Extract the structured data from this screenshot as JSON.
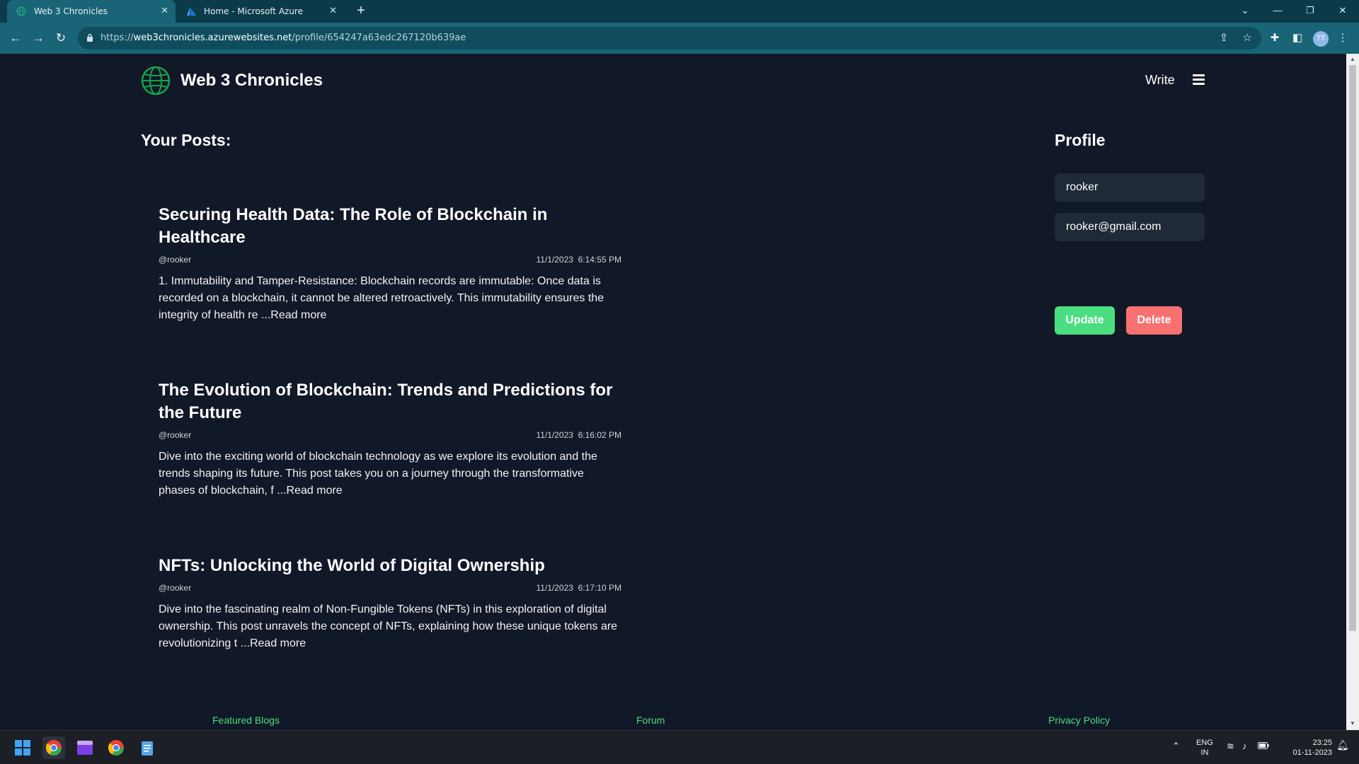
{
  "browser": {
    "tabs": [
      {
        "title": "Web 3 Chronicles"
      },
      {
        "title": "Home - Microsoft Azure"
      }
    ],
    "url_prefix": "https://",
    "url_host": "web3chronicles.azurewebsites.net",
    "url_path": "/profile/654247a63edc267120b639ae",
    "avatar_initials": "TT"
  },
  "site": {
    "title": "Web 3 Chronicles",
    "write_label": "Write"
  },
  "posts_heading": "Your Posts:",
  "posts": [
    {
      "title": "Securing Health Data: The Role of Blockchain in Healthcare",
      "author": "@rooker",
      "date": "11/1/2023",
      "time": "6:14:55 PM",
      "excerpt": "1. Immutability and Tamper-Resistance: Blockchain records are immutable: Once data is recorded on a blockchain, it cannot be altered retroactively. This immutability ensures the integrity of health re ",
      "read_more": "...Read more"
    },
    {
      "title": "The Evolution of Blockchain: Trends and Predictions for the Future",
      "author": "@rooker",
      "date": "11/1/2023",
      "time": "6:16:02 PM",
      "excerpt": "Dive into the exciting world of blockchain technology as we explore its evolution and the trends shaping its future. This post takes you on a journey through the transformative phases of blockchain, f ",
      "read_more": "...Read more"
    },
    {
      "title": "NFTs: Unlocking the World of Digital Ownership",
      "author": "@rooker",
      "date": "11/1/2023",
      "time": "6:17:10 PM",
      "excerpt": "Dive into the fascinating realm of Non-Fungible Tokens (NFTs) in this exploration of digital ownership. This post unravels the concept of NFTs, explaining how these unique tokens are revolutionizing t ",
      "read_more": "...Read more"
    }
  ],
  "profile": {
    "heading": "Profile",
    "username": "rooker",
    "email": "rooker@gmail.com",
    "update_label": "Update",
    "delete_label": "Delete"
  },
  "footer": {
    "featured": "Featured Blogs",
    "forum": "Forum",
    "privacy": "Privacy Policy"
  },
  "taskbar": {
    "lang_top": "ENG",
    "lang_bottom": "IN",
    "time": "23:25",
    "date": "01-11-2023"
  },
  "colors": {
    "accent_green": "#4ade80",
    "danger_red": "#f87171",
    "page_bg": "#111827",
    "field_bg": "#1f2937",
    "chrome_teal": "#1a6477"
  }
}
